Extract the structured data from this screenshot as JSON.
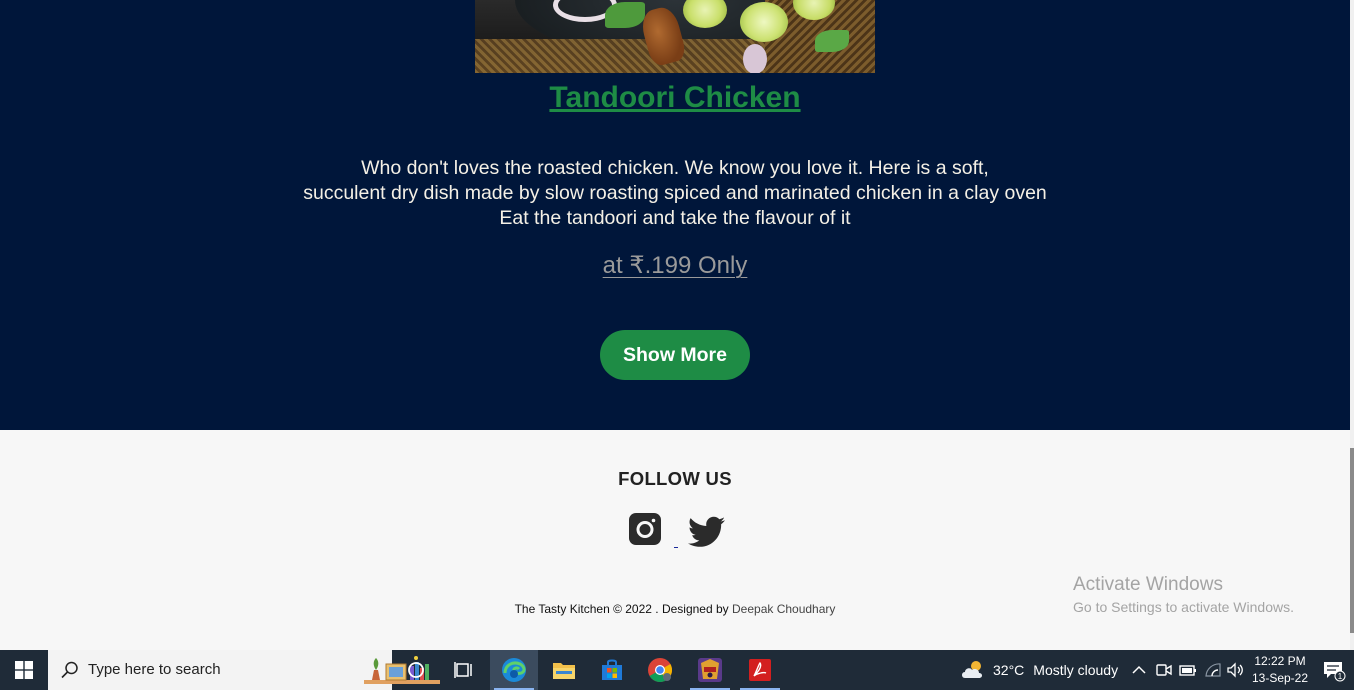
{
  "hero": {
    "dish_title": "Tandoori Chicken",
    "desc_line1": "Who don't loves the roasted chicken. We know you love it. Here is a soft,",
    "desc_line2": "succulent dry dish made by slow roasting spiced and marinated chicken in a clay oven",
    "desc_line3": "Eat the tandoori and take the flavour of it",
    "price": "at ₹.199 Only",
    "show_more": "Show More"
  },
  "footer": {
    "follow": "FOLLOW US",
    "credits_prefix": "The Tasty Kitchen © 2022 . Designed by",
    "author": "Deepak Choudhary"
  },
  "watermark": {
    "title": "Activate Windows",
    "subtitle": "Go to Settings to activate Windows."
  },
  "taskbar": {
    "search_placeholder": "Type here to search",
    "weather_temp": "32°C",
    "weather_text": "Mostly cloudy",
    "time": "12:22 PM",
    "date": "13-Sep-22",
    "notification_count": "1"
  },
  "colors": {
    "hero_bg": "#00163a",
    "accent_green": "#1e8c45",
    "footer_bg": "#f7f7f7"
  }
}
